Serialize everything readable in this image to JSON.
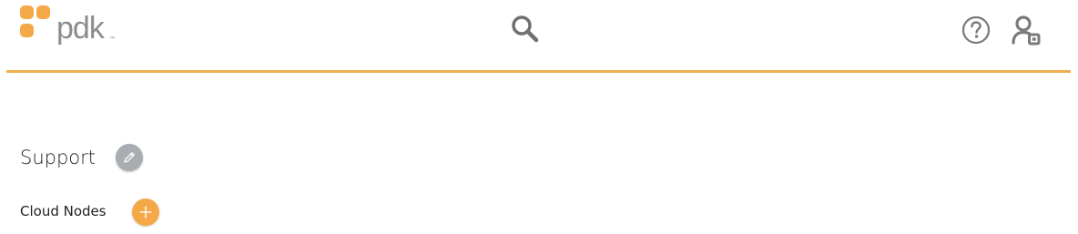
{
  "header": {
    "logo_text": "pdk",
    "logo_tm": "™",
    "brand_color": "#f0ad4e",
    "icons": {
      "search": "search-icon",
      "help": "help-icon",
      "user": "user-settings-icon"
    }
  },
  "section": {
    "title": "Support",
    "edit_icon": "pencil-icon"
  },
  "cloud_nodes": {
    "label": "Cloud Nodes",
    "add_icon": "plus-icon",
    "add_color": "#f5a847"
  }
}
